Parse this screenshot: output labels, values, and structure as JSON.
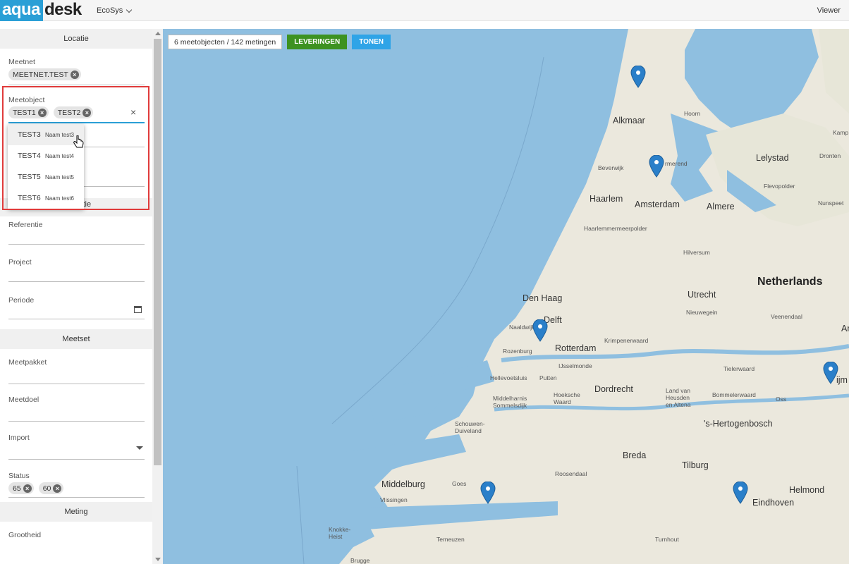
{
  "header": {
    "logo_left": "aqua",
    "logo_right": "desk",
    "app_name": "EcoSys",
    "role": "Viewer"
  },
  "sidebar": {
    "locatie": {
      "title": "Locatie",
      "meetnet_label": "Meetnet",
      "meetnet_chips": [
        "MEETNET.TEST"
      ],
      "meetobject_label": "Meetobject",
      "meetobject_chips": [
        "TEST1",
        "TEST2"
      ]
    },
    "dropdown_options": [
      {
        "code": "TEST3",
        "name": "Naam test3"
      },
      {
        "code": "TEST4",
        "name": "Naam test4"
      },
      {
        "code": "TEST5",
        "name": "Naam test5"
      },
      {
        "code": "TEST6",
        "name": "Naam test6"
      }
    ],
    "collectie": {
      "title": "Collectie",
      "referentie_label": "Referentie",
      "project_label": "Project",
      "periode_label": "Periode"
    },
    "meetset": {
      "title": "Meetset",
      "meetpakket_label": "Meetpakket",
      "meetdoel_label": "Meetdoel",
      "import_label": "Import",
      "status_label": "Status",
      "status_chips": [
        "65",
        "60"
      ]
    },
    "meting": {
      "title": "Meting",
      "grootheid_label": "Grootheid"
    }
  },
  "map": {
    "counter": "6 meetobjecten / 142 metingen",
    "btn_leveringen": "LEVERINGEN",
    "btn_tonen": "TONEN",
    "places_major": [
      "Alkmaar",
      "Lelystad",
      "Haarlem",
      "Amsterdam",
      "Almere",
      "Den Haag",
      "Utrecht",
      "Delft",
      "Rotterdam",
      "Dordrecht",
      "'s-Hertogenbosch",
      "Breda",
      "Tilburg",
      "Middelburg",
      "Helmond",
      "Eindhoven"
    ],
    "country": "Netherlands",
    "places_minor": [
      "Hoorn",
      "Beverwijk",
      "rmerend",
      "Dronten",
      "Kamp",
      "Flevopolder",
      "Nunspeet",
      "Haarlemmermeerpolder",
      "Hilversum",
      "Nieuwegein",
      "Veenendaal",
      "Naaldwijk",
      "Rozenburg",
      "Krimpenerwaard",
      "IJsselmonde",
      "Hellevoetsluis",
      "Putten",
      "Tielerwaard",
      "Middelharnis Sommelsdijk",
      "Hoeksche Waard",
      "Land van Heusden en Altena",
      "Bommelerwaard",
      "Oss",
      "Schouwen-Duiveland",
      "Roosendaal",
      "Goes",
      "Vlissingen",
      "Knokke-Heist",
      "Terneuzen",
      "Turnhout",
      "Brugge",
      "Ar",
      "ijm"
    ],
    "colors": {
      "water": "#8fbfe0",
      "land": "#ebe8dd",
      "button_green": "#3d9221",
      "button_blue": "#2fa4e7",
      "marker": "#2a7fc9"
    }
  }
}
